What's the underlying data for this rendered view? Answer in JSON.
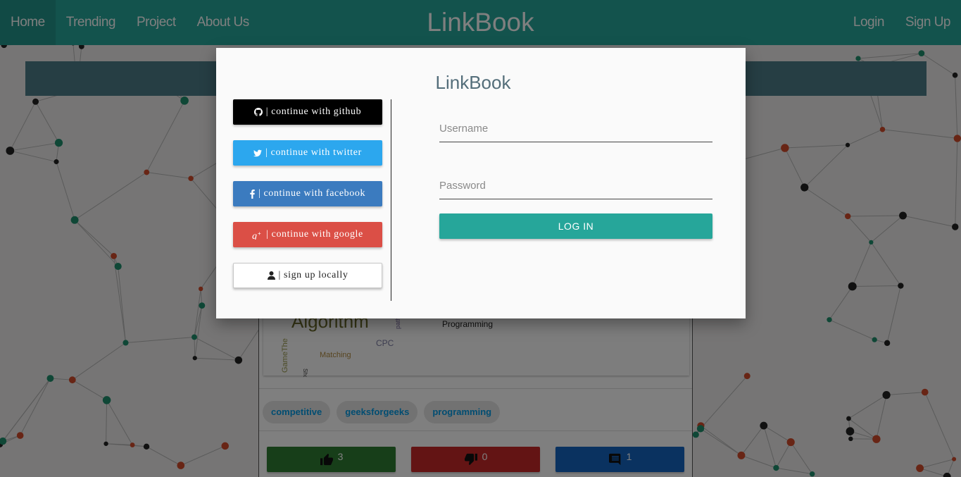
{
  "navbar": {
    "brand": "LinkBook",
    "left_items": [
      "Home",
      "Trending",
      "Project",
      "About Us"
    ],
    "active_item": "Home",
    "right_items": [
      "Login",
      "Sign Up"
    ],
    "color": "#26a69a"
  },
  "post": {
    "title_fragment": "Programming",
    "wordcloud_words": [
      "Algorithm",
      "GameThe",
      "Shortest",
      "Matching",
      "CPC",
      "path"
    ],
    "tags": [
      "competitive",
      "geeksforgeeks",
      "programming"
    ],
    "votes": {
      "up": "3",
      "down": "0",
      "comments": "1"
    },
    "vote_colors": {
      "up": "#2e7d32",
      "down": "#c62828",
      "comments": "#1565c0"
    }
  },
  "modal": {
    "title": "LinkBook",
    "social_buttons": [
      {
        "icon": "github-icon",
        "label": "| continue with github"
      },
      {
        "icon": "twitter-icon",
        "label": "| continue with twitter"
      },
      {
        "icon": "facebook-icon",
        "label": "| continue with facebook"
      },
      {
        "icon": "google-plus-icon",
        "label": "| continue with google"
      },
      {
        "icon": "user-icon",
        "label": "| sign up locally"
      }
    ],
    "username_placeholder": "Username",
    "password_placeholder": "Password",
    "login_label": "LOG IN"
  }
}
